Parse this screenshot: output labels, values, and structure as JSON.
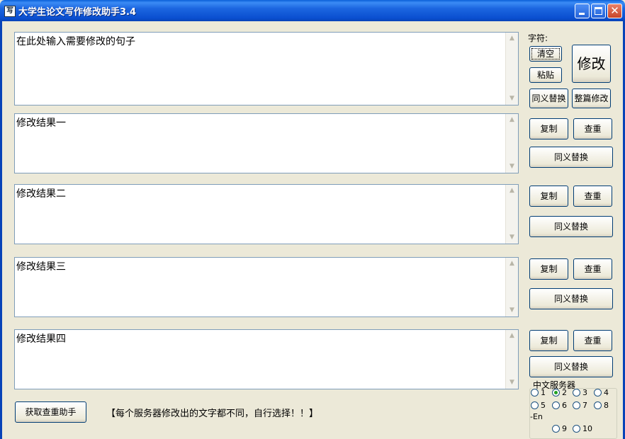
{
  "window": {
    "title": "大学生论文写作修改助手3.4"
  },
  "input": {
    "placeholder_text": "在此处输入需要修改的句子"
  },
  "results": [
    {
      "text": "修改结果一",
      "copy": "复制",
      "check": "查重",
      "synonym": "同义替换"
    },
    {
      "text": "修改结果二",
      "copy": "复制",
      "check": "查重",
      "synonym": "同义替换"
    },
    {
      "text": "修改结果三",
      "copy": "复制",
      "check": "查重",
      "synonym": "同义替换"
    },
    {
      "text": "修改结果四",
      "copy": "复制",
      "check": "查重",
      "synonym": "同义替换"
    }
  ],
  "controls": {
    "char_label": "字符:",
    "clear": "清空",
    "paste": "粘贴",
    "modify": "修改",
    "synonym_replace": "同义替换",
    "full_modify": "整篇修改"
  },
  "footer": {
    "get_check_helper": "获取查重助手",
    "notice": "【每个服务器修改出的文字都不同，自行选择！！】"
  },
  "servers": {
    "title": "中文服务器",
    "options": [
      "1",
      "2",
      "3",
      "4",
      "5",
      "6",
      "7",
      "8",
      "9",
      "10"
    ],
    "selected": "2",
    "en_label": "-En"
  }
}
